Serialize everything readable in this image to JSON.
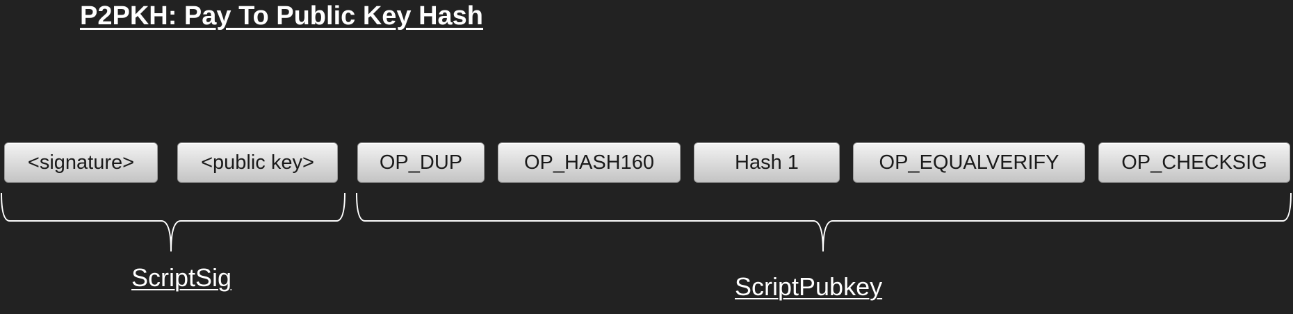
{
  "title": "P2PKH: Pay To Public Key Hash",
  "tokens": [
    "<signature>",
    "<public key>",
    "OP_DUP",
    "OP_HASH160",
    "Hash 1",
    "OP_EQUALVERIFY",
    "OP_CHECKSIG"
  ],
  "groups": {
    "script_sig": "ScriptSig",
    "script_pubkey": "ScriptPubkey"
  },
  "colors": {
    "background": "#222222",
    "box_top": "#f3f3f3",
    "box_bottom": "#c4c4c4",
    "text": "#ffffff"
  }
}
